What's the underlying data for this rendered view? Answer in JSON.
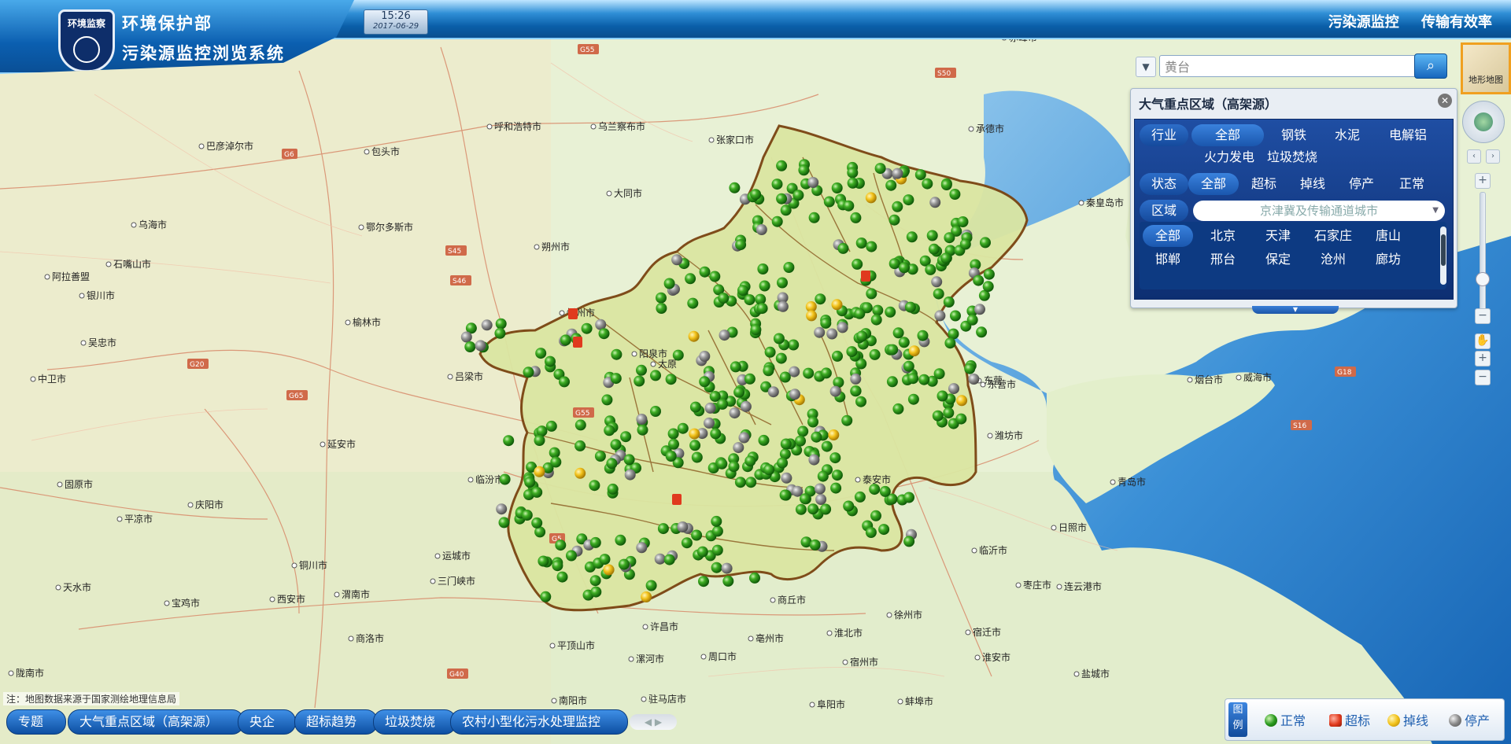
{
  "header": {
    "logo_text": "环境监察",
    "org_name": "环境保护部",
    "system_name": "污染源监控浏览系统",
    "time": "15:26",
    "date": "2017-06-29",
    "links": [
      "污染源监控",
      "传输有效率"
    ]
  },
  "search": {
    "value": "黄台",
    "arrow_icon": "caret-down-icon",
    "button_icon": "search-icon"
  },
  "terrain_button": {
    "label": "地形地图"
  },
  "panel": {
    "title": "大气重点区域（高架源）",
    "industry": {
      "label": "行业",
      "options": [
        "全部",
        "钢铁",
        "水泥",
        "电解铝",
        "火力发电",
        "垃圾焚烧"
      ],
      "selected": "全部"
    },
    "status": {
      "label": "状态",
      "options": [
        "全部",
        "超标",
        "掉线",
        "停产",
        "正常"
      ],
      "selected": "全部"
    },
    "region": {
      "label": "区域",
      "value": "京津冀及传输通道城市"
    },
    "cities": [
      "全部",
      "北京",
      "天津",
      "石家庄",
      "唐山",
      "邯郸",
      "邢台",
      "保定",
      "沧州",
      "廊坊"
    ],
    "city_selected": "全部"
  },
  "map": {
    "cities": [
      {
        "name": "赤峰市"
      },
      {
        "name": "乌兰察布市"
      },
      {
        "name": "张家口市"
      },
      {
        "name": "承德市"
      },
      {
        "name": "呼和浩特市"
      },
      {
        "name": "巴彦淖尔市"
      },
      {
        "name": "包头市"
      },
      {
        "name": "大同市"
      },
      {
        "name": "秦皇岛市"
      },
      {
        "name": "乌海市"
      },
      {
        "name": "鄂尔多斯市"
      },
      {
        "name": "朔州市"
      },
      {
        "name": "石嘴山市"
      },
      {
        "name": "阿拉善盟"
      },
      {
        "name": "银川市"
      },
      {
        "name": "忻州市"
      },
      {
        "name": "榆林市"
      },
      {
        "name": "吴忠市"
      },
      {
        "name": "阳泉市"
      },
      {
        "name": "中卫市"
      },
      {
        "name": "吕梁市"
      },
      {
        "name": "东营市"
      },
      {
        "name": "烟台市"
      },
      {
        "name": "威海市"
      },
      {
        "name": "延安市"
      },
      {
        "name": "潍坊市"
      },
      {
        "name": "临汾市"
      },
      {
        "name": "固原市"
      },
      {
        "name": "庆阳市"
      },
      {
        "name": "平凉市"
      },
      {
        "name": "泰安市"
      },
      {
        "name": "青岛市"
      },
      {
        "name": "日照市"
      },
      {
        "name": "运城市"
      },
      {
        "name": "铜川市"
      },
      {
        "name": "临沂市"
      },
      {
        "name": "天水市"
      },
      {
        "name": "三门峡市"
      },
      {
        "name": "枣庄市"
      },
      {
        "name": "连云港市"
      },
      {
        "name": "宝鸡市"
      },
      {
        "name": "西安市"
      },
      {
        "name": "渭南市"
      },
      {
        "name": "商丘市"
      },
      {
        "name": "徐州市"
      },
      {
        "name": "许昌市"
      },
      {
        "name": "宿迁市"
      },
      {
        "name": "商洛市"
      },
      {
        "name": "平顶山市"
      },
      {
        "name": "亳州市"
      },
      {
        "name": "淮北市"
      },
      {
        "name": "宿州市"
      },
      {
        "name": "漯河市"
      },
      {
        "name": "周口市"
      },
      {
        "name": "淮安市"
      },
      {
        "name": "盐城市"
      },
      {
        "name": "南阳市"
      },
      {
        "name": "驻马店市"
      },
      {
        "name": "陇南市"
      },
      {
        "name": "阜阳市"
      },
      {
        "name": "蚌埠市"
      },
      {
        "name": "东营"
      },
      {
        "name": "太原"
      }
    ],
    "roads": [
      "G6",
      "G55",
      "S50",
      "S45",
      "S46",
      "G65",
      "G20",
      "G18",
      "S16",
      "G5",
      "G40",
      "G55"
    ]
  },
  "source_note": "注：地图数据来源于国家测绘地理信息局",
  "bottom_tabs": [
    "专题",
    "大气重点区域（高架源）",
    "央企",
    "超标趋势",
    "垃圾焚烧",
    "农村小型化污水处理监控"
  ],
  "legend": {
    "title": "图例",
    "items": [
      {
        "label": "正常",
        "color": "#2a9a1e"
      },
      {
        "label": "超标",
        "color": "#e03a1e"
      },
      {
        "label": "掉线",
        "color": "#f2c21a"
      },
      {
        "label": "停产",
        "color": "#888888"
      }
    ]
  },
  "colors": {
    "region_fill": "#dbe6a2",
    "region_border": "#7a4410",
    "sea": "#3a8fd6",
    "accent": "#0a5ea8"
  }
}
